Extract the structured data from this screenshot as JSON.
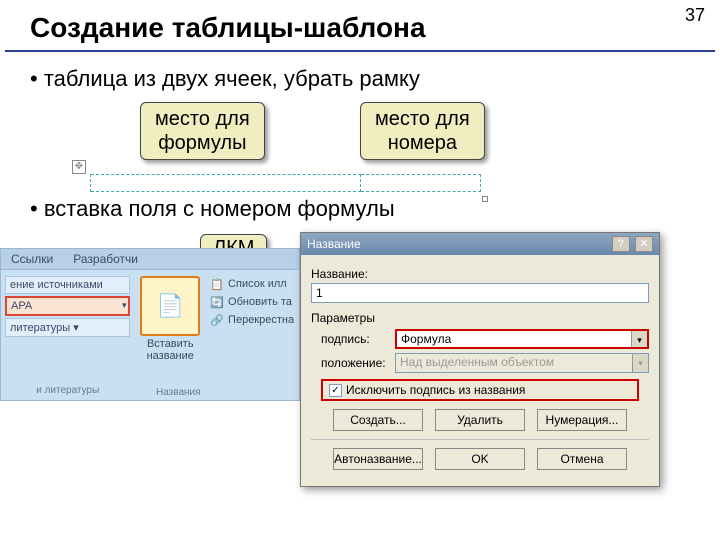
{
  "page_number": "37",
  "title": "Создание таблицы-шаблона",
  "bullet1": "• таблица из двух ячеек, убрать рамку",
  "callout_formula": "место для\nформулы",
  "callout_number": "место для\nномера",
  "bullet2": "• вставка поля с номером формулы",
  "lkm": "ЛКМ",
  "ribbon": {
    "tab1": "Ссылки",
    "tab2": "Разработчи",
    "sources": "ение источниками",
    "apa": "APA",
    "lit": "литературы ▾",
    "lit2": "и литературы",
    "big_button": "Вставить\nназвание",
    "list_illus": "Список илл",
    "update_ta": "Обновить та",
    "crossref": "Перекрестна",
    "group": "Названия"
  },
  "dialog": {
    "title": "Название",
    "name_label": "Название:",
    "name_value": "1",
    "params": "Параметры",
    "caption_label": "подпись:",
    "caption_value": "Формула",
    "position_label": "положение:",
    "position_value": "Над выделенным объектом",
    "exclude": "Исключить подпись из названия",
    "create": "Создать...",
    "delete": "Удалить",
    "numbering": "Нумерация...",
    "autoname": "Автоназвание...",
    "ok": "OK",
    "cancel": "Отмена"
  }
}
